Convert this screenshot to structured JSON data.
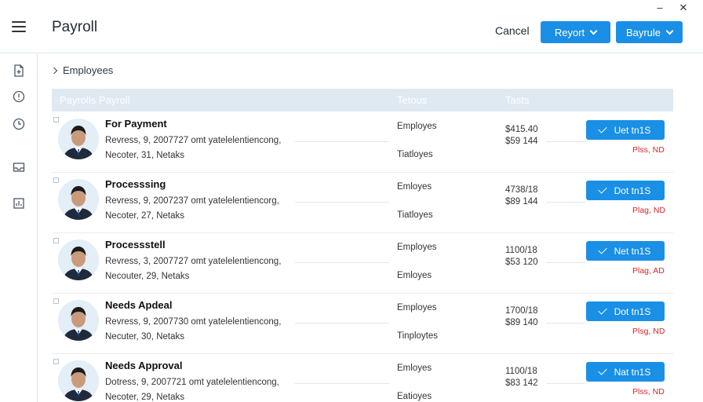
{
  "window": {
    "minimize": "–",
    "close": "✕"
  },
  "header": {
    "title": "Payroll",
    "cancel_label": "Cancel",
    "report_label": "Reyort",
    "payrule_label": "Bayrule"
  },
  "sidebar": {
    "icons": [
      "document-add-icon",
      "info-icon",
      "clock-icon",
      "inbox-icon",
      "report-icon"
    ]
  },
  "breadcrumb": {
    "label": "Employees"
  },
  "table": {
    "columns": {
      "name": "Payrolls Payroll",
      "status": "Tetous",
      "tasks": "Tasts"
    }
  },
  "rows": [
    {
      "title": "For Payment",
      "line1": "Revress, 9, 2007727 omt yatelelentiencong,",
      "line2": "Necoter, 31, Netaks",
      "status1": "Employes",
      "status2": "Tiatloyes",
      "amount1": "$415.40",
      "amount2": "$59 144",
      "button": "Uet tn1S",
      "badge": "Plss, ND"
    },
    {
      "title": "Processsing",
      "line1": "Revress, 9, 2007237 omt yatelelentiencorg,",
      "line2": "Necoter, 27, Netaks",
      "status1": "Emloyes",
      "status2": "Tiatloyes",
      "amount1": "4738/18",
      "amount2": "$89 144",
      "button": "Dot tn1S",
      "badge": "Plag, ND"
    },
    {
      "title": "Processstell",
      "line1": "Revress, 3, 2007727 omt yatelelentiencong,",
      "line2": "Necouter, 29, Netaks",
      "status1": "Employes",
      "status2": "Emloyes",
      "amount1": "1100/18",
      "amount2": "$53 120",
      "button": "Net tn1S",
      "badge": "Plag, AD"
    },
    {
      "title": "Needs Apdeal",
      "line1": "Revress, 9, 2007730 omt yatelelentiencong,",
      "line2": "Necuter, 30, Netaks",
      "status1": "Employes",
      "status2": "Tinploytes",
      "amount1": "1700/18",
      "amount2": "$89 140",
      "button": "Dot tn1S",
      "badge": "Plsg, ND"
    },
    {
      "title": "Needs Approval",
      "line1": "Dotress, 9, 2007721 omt yatelelentiencong,",
      "line2": "Necoter, 29, Netaks",
      "status1": "Emloyes",
      "status2": "Eatioyes",
      "amount1": "1100/18",
      "amount2": "$83 142",
      "button": "Nat tn1S",
      "badge": "Plss, ND"
    }
  ],
  "colors": {
    "accent": "#1a8fe6",
    "header_bg": "#dfe9f2",
    "badge": "#d8262b"
  }
}
